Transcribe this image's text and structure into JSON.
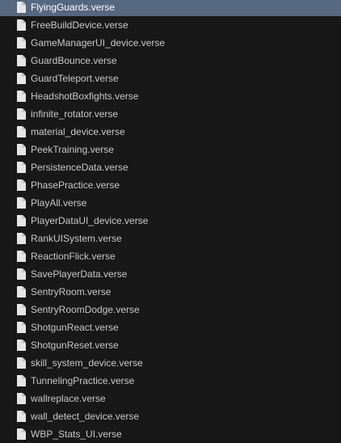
{
  "file_list": {
    "selected_index": 0,
    "icon": "file-icon",
    "colors": {
      "background": "#181818",
      "selected_background": "#55687f",
      "text": "#c8c8c8",
      "selected_text": "#ffffff",
      "icon": "#e6e6e6"
    },
    "files": [
      "FlyingGuards.verse",
      "FreeBuildDevice.verse",
      "GameManagerUI_device.verse",
      "GuardBounce.verse",
      "GuardTeleport.verse",
      "HeadshotBoxfights.verse",
      "infinite_rotator.verse",
      "material_device.verse",
      "PeekTraining.verse",
      "PersistenceData.verse",
      "PhasePractice.verse",
      "PlayAll.verse",
      "PlayerDataUI_device.verse",
      "RankUISystem.verse",
      "ReactionFlick.verse",
      "SavePlayerData.verse",
      "SentryRoom.verse",
      "SentryRoomDodge.verse",
      "ShotgunReact.verse",
      "ShotgunReset.verse",
      "skill_system_device.verse",
      "TunnelingPractice.verse",
      "wallreplace.verse",
      "wall_detect_device.verse",
      "WBP_Stats_UI.verse"
    ]
  }
}
